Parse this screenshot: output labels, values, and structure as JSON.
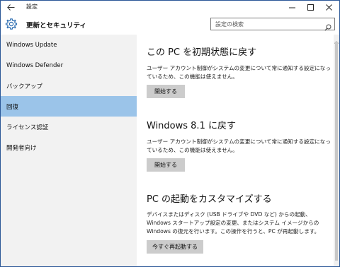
{
  "titlebar": {
    "title": "設定",
    "back_icon": "back-arrow-icon",
    "minimize": "—",
    "maximize": "☐",
    "close": "✕"
  },
  "header": {
    "section_title": "更新とセキュリティ",
    "icon": "gear-icon",
    "search_placeholder": "設定の検索",
    "search_icon": "search-icon"
  },
  "sidebar": {
    "selected_index": 3,
    "selected_color": "#9bc4e9",
    "items": [
      {
        "label": "Windows Update"
      },
      {
        "label": "Windows Defender"
      },
      {
        "label": "バックアップ"
      },
      {
        "label": "回復"
      },
      {
        "label": "ライセンス認証"
      },
      {
        "label": "開発者向け"
      }
    ]
  },
  "main": {
    "sections": [
      {
        "heading": "この PC を初期状態に戻す",
        "description": "ユーザー アカウント制御がシステムの変更について常に通知する設定になっているため、この機能は使えません。",
        "button": "開始する"
      },
      {
        "heading": "Windows 8.1 に戻す",
        "description": "ユーザー アカウント制御がシステムの変更について常に通知する設定になっているため、この機能は使えません。",
        "button": "開始する"
      },
      {
        "heading": "PC の起動をカスタマイズする",
        "description": "デバイスまたはディスク (USB ドライブや DVD など) からの起動、Windows スタートアップ設定の変更、またはシステム イメージからの Windows の復元を行います。この操作を行うと、PC が再起動します。",
        "button": "今すぐ再起動する"
      }
    ]
  },
  "colors": {
    "window_border": "#2b5797",
    "sidebar_bg": "#f2f2f2",
    "button_bg": "#cccccc"
  }
}
